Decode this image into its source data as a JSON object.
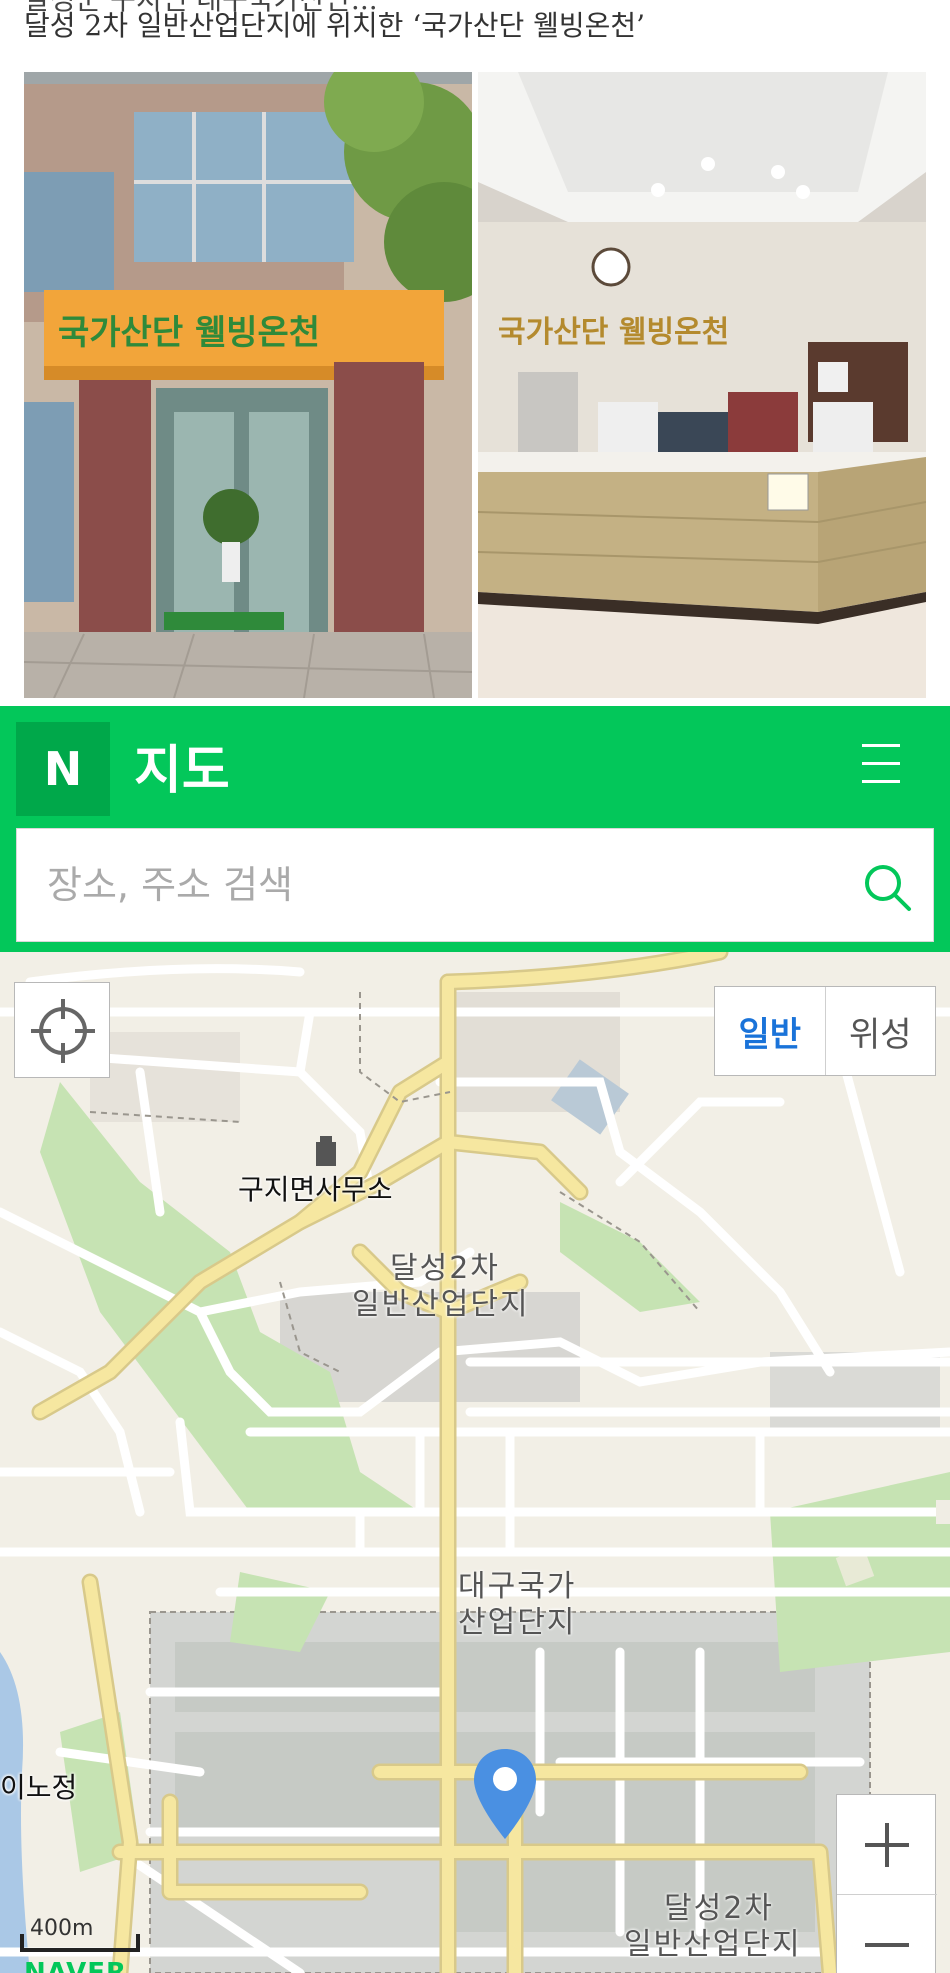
{
  "caption": {
    "cut_line": "달성군 구지면 대구국가산단...",
    "text": "달성 2차 일반산업단지에 위치한 ‘국가산단 웰빙온천’"
  },
  "photos": {
    "left_sign": "국가산단 웰빙온천",
    "right_sign": "국가산단 웰빙온천"
  },
  "map_header": {
    "logo": "N",
    "title": "지도",
    "menu_icon": "hamburger-icon",
    "search_placeholder": "장소, 주소 검색",
    "search_icon": "search-icon"
  },
  "map": {
    "locate_icon": "crosshair-icon",
    "type_toggle": {
      "normal": "일반",
      "satellite": "위성",
      "selected": "일반"
    },
    "labels": {
      "office": "구지면사무소",
      "complex1_line1": "달성2차",
      "complex1_line2": "일반산업단지",
      "national_line1": "대구국가",
      "national_line2": "산업단지",
      "inojeong": "이노정",
      "complex2_line1": "달성2차",
      "complex2_line2": "일반산업단지"
    },
    "zoom": {
      "in": "+",
      "out": "−"
    },
    "scale": "400m",
    "watermark": "NAVER",
    "pin_icon": "location-pin-icon",
    "colors": {
      "accent": "#03c75a",
      "pin": "#4a90e2",
      "road_major": "#f6e7a0",
      "park": "#c6e3b3",
      "water": "#aac8e6"
    }
  }
}
